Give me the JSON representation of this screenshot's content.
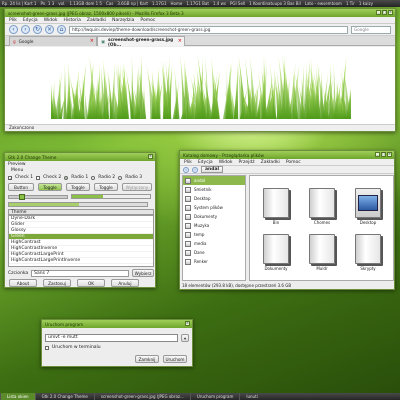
{
  "top_panel": {
    "items": [
      "Rp. 24 lis | Kart 1",
      "Pn. 1 3",
      "vol.",
      "1.13GB dom 1 5",
      "Cas",
      "3.6GB np | Kart",
      "1.17G1",
      "Home",
      "1.17G1 Bat",
      "1.4 ws",
      "PGI Sell",
      "1 Koordinatuupo 3 Bas Bil",
      "Lato - ewsemtoom",
      "1 Tir",
      "1 kaizy"
    ]
  },
  "firefox": {
    "title": "screenshot-green-grass.jpg (JPEG obraz, 1500x800 pikseli) - Mozilla Firefox 3 Beta 3",
    "menu": [
      "Plik",
      "Edycja",
      "Widok",
      "Historia",
      "Zakładki",
      "Narzędzia",
      "Pomoc"
    ],
    "url": "http://lwquini.deviep/theme-download/screenshot-green-grass.jpg",
    "search_placeholder": "Google",
    "tabs": [
      {
        "label": "Google"
      },
      {
        "label": "screenshot-green-grass.jpg (Ob..."
      }
    ],
    "status": "Zakończono"
  },
  "gtk_theme": {
    "title": "Gtk 2.0 Change Theme",
    "preview_label": "Preview",
    "menu_label": "Menu",
    "checks": [
      "Check 1",
      "Check 2"
    ],
    "radios": [
      "Radio 1",
      "Radio 2",
      "Radio 3"
    ],
    "buttons": [
      "Button",
      "Toggle",
      "Toggle",
      "Toggle"
    ],
    "disabled_label": "Wyłączony",
    "theme_header": "Theme",
    "themes": [
      "Dyne-Dark",
      "Glider",
      "Glossy",
      "Green",
      "HighContrast",
      "HighContrastInverse",
      "HighContrastLargePrint",
      "HighContrastLargePrintInverse"
    ],
    "selected_theme": "Green",
    "font_label": "Czcionka",
    "font_value": "Sans 7",
    "font_button": "Wybierz",
    "bottom_buttons": [
      "About",
      "Zastosuj",
      "OK",
      "Anuluj"
    ]
  },
  "nautilus": {
    "title": "Katalog domowy - Przeglądarka plików",
    "menu": [
      "Plik",
      "Edycja",
      "Widok",
      "Przejdź",
      "Zakładki",
      "Pomoc"
    ],
    "location": "andal",
    "sidebar": [
      {
        "label": "andal",
        "selected": true
      },
      {
        "label": "Smietnik",
        "selected": false
      },
      {
        "label": "Desktop",
        "selected": false
      },
      {
        "label": "System plików",
        "selected": false
      },
      {
        "label": "Dokumenty",
        "selected": false
      },
      {
        "label": "Muzyka",
        "selected": false
      },
      {
        "label": "temp",
        "selected": false
      },
      {
        "label": "media",
        "selected": false
      },
      {
        "label": "Dane",
        "selected": false
      },
      {
        "label": "Renker",
        "selected": false
      }
    ],
    "files": [
      {
        "label": "Bin",
        "icon": "folder-icon"
      },
      {
        "label": "Chomes",
        "icon": "folder-icon"
      },
      {
        "label": "Desktop",
        "icon": "desktop-folder-icon"
      },
      {
        "label": "Dokumenty",
        "icon": "folder-icon"
      },
      {
        "label": "Muldr",
        "icon": "folder-icon"
      },
      {
        "label": "Skrypty",
        "icon": "folder-icon"
      }
    ],
    "status": "18 elementów (293.8 kB), dostępne przestrzeń 3.6 GB"
  },
  "run_dialog": {
    "title": "Uruchom program",
    "command": "urxvt -e mutt",
    "terminal_label": "Uruchom w terminalu",
    "buttons": [
      "Zamknij",
      "Uruchom"
    ]
  },
  "bottom_panel": {
    "tasks": [
      {
        "label": "Lista okien",
        "active": true
      },
      {
        "label": "Gtk 2.0 Change Theme",
        "active": false
      },
      {
        "label": "screenshot-green-grass.jpg (JPEG obraz...",
        "active": false
      },
      {
        "label": "Uruchom program",
        "active": false
      },
      {
        "label": "lunuti",
        "active": false
      }
    ]
  }
}
